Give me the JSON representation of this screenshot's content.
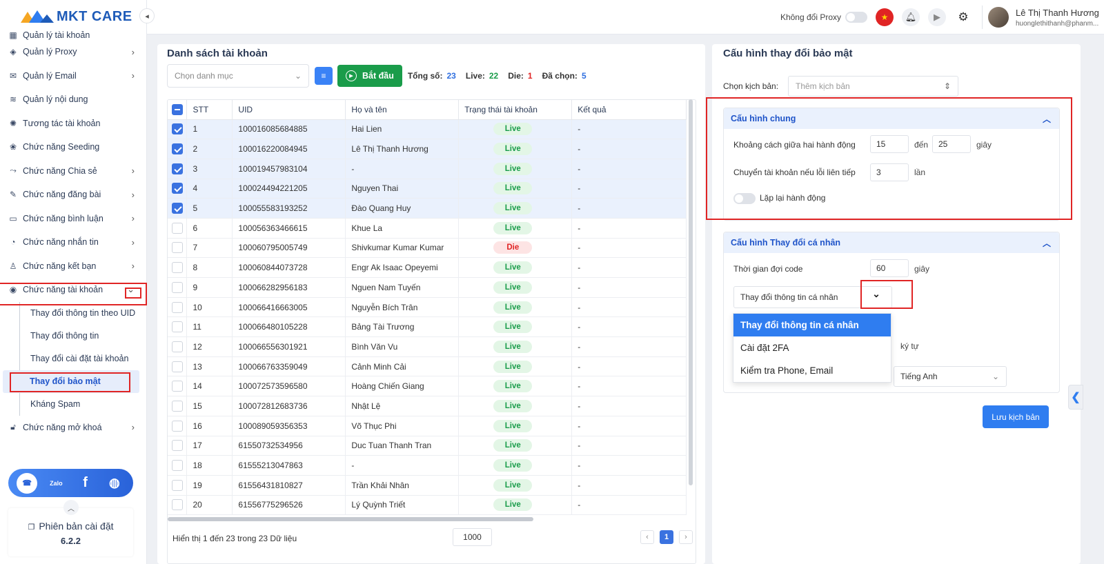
{
  "app": {
    "brand": "MKT CARE"
  },
  "sidebar": {
    "items": [
      {
        "label": "Quản lý tài khoản",
        "icon": "grid-icon"
      },
      {
        "label": "Quản lý Proxy",
        "icon": "layers-icon",
        "arrow": true
      },
      {
        "label": "Quản lý Email",
        "icon": "mail-icon",
        "arrow": true
      },
      {
        "label": "Quản lý nội dung",
        "icon": "content-icon"
      },
      {
        "label": "Tương tác tài khoản",
        "icon": "interact-icon"
      },
      {
        "label": "Chức năng Seeding",
        "icon": "seeding-icon"
      },
      {
        "label": "Chức năng Chia sẻ",
        "icon": "share-icon",
        "arrow": true
      },
      {
        "label": "Chức năng đăng bài",
        "icon": "post-icon",
        "arrow": true
      },
      {
        "label": "Chức năng bình luận",
        "icon": "comment-icon",
        "arrow": true
      },
      {
        "label": "Chức năng nhắn tin",
        "icon": "message-icon",
        "arrow": true
      },
      {
        "label": "Chức năng kết bạn",
        "icon": "add-friend-icon",
        "arrow": true
      },
      {
        "label": "Chức năng tài khoản",
        "icon": "user-circle-icon",
        "open": true
      }
    ],
    "subitems": [
      {
        "label": "Thay đổi thông tin theo UID"
      },
      {
        "label": "Thay đổi thông tin"
      },
      {
        "label": "Thay đổi cài đặt tài khoản"
      },
      {
        "label": "Thay đổi bảo mật",
        "active": true
      },
      {
        "label": "Kháng Spam"
      }
    ],
    "after": {
      "label": "Chức năng mở khoá",
      "icon": "lock-icon"
    },
    "version_label": "Phiên bản cài đặt",
    "version_number": "6.2.2"
  },
  "topbar": {
    "proxy_label": "Không đổi Proxy",
    "user_name": "Lê Thị Thanh Hương",
    "user_email": "huonglethithanh@phanm..."
  },
  "accounts": {
    "title": "Danh sách tài khoản",
    "category_placeholder": "Chọn danh mục",
    "start_label": "Bắt đầu",
    "stats": {
      "total_label": "Tổng số:",
      "total": "23",
      "live_label": "Live:",
      "live": "22",
      "die_label": "Die:",
      "die": "1",
      "selected_label": "Đã chọn:",
      "selected": "5"
    },
    "columns": [
      "STT",
      "UID",
      "Họ và tên",
      "Trạng thái tài khoản",
      "Kết quả"
    ],
    "rows": [
      {
        "stt": "1",
        "uid": "100016085684885",
        "name": "Hai Lien",
        "status": "Live",
        "result": "-",
        "checked": true
      },
      {
        "stt": "2",
        "uid": "100016220084945",
        "name": "Lê Thị Thanh Hương",
        "status": "Live",
        "result": "-",
        "checked": true
      },
      {
        "stt": "3",
        "uid": "100019457983104",
        "name": "-",
        "status": "Live",
        "result": "-",
        "checked": true
      },
      {
        "stt": "4",
        "uid": "100024494221205",
        "name": "Nguyen Thai",
        "status": "Live",
        "result": "-",
        "checked": true
      },
      {
        "stt": "5",
        "uid": "100055583193252",
        "name": "Đào Quang Huy",
        "status": "Live",
        "result": "-",
        "checked": true
      },
      {
        "stt": "6",
        "uid": "100056363466615",
        "name": "Khue La",
        "status": "Live",
        "result": "-",
        "checked": false
      },
      {
        "stt": "7",
        "uid": "100060795005749",
        "name": "Shivkumar Kumar Kumar",
        "status": "Die",
        "result": "-",
        "checked": false
      },
      {
        "stt": "8",
        "uid": "100060844073728",
        "name": "Engr Ak Isaac Opeyemi",
        "status": "Live",
        "result": "-",
        "checked": false
      },
      {
        "stt": "9",
        "uid": "100066282956183",
        "name": "Nguen Nam Tuyến",
        "status": "Live",
        "result": "-",
        "checked": false
      },
      {
        "stt": "10",
        "uid": "100066416663005",
        "name": "Nguyễn Bích Trân",
        "status": "Live",
        "result": "-",
        "checked": false
      },
      {
        "stt": "11",
        "uid": "100066480105228",
        "name": "Bảng Tài Trương",
        "status": "Live",
        "result": "-",
        "checked": false
      },
      {
        "stt": "12",
        "uid": "100066556301921",
        "name": "Bình Văn Vu",
        "status": "Live",
        "result": "-",
        "checked": false
      },
      {
        "stt": "13",
        "uid": "100066763359049",
        "name": "Cảnh Minh Cải",
        "status": "Live",
        "result": "-",
        "checked": false
      },
      {
        "stt": "14",
        "uid": "100072573596580",
        "name": "Hoàng Chiến Giang",
        "status": "Live",
        "result": "-",
        "checked": false
      },
      {
        "stt": "15",
        "uid": "100072812683736",
        "name": "Nhật Lệ",
        "status": "Live",
        "result": "-",
        "checked": false
      },
      {
        "stt": "16",
        "uid": "100089059356353",
        "name": "Võ Thục Phi",
        "status": "Live",
        "result": "-",
        "checked": false
      },
      {
        "stt": "17",
        "uid": "61550732534956",
        "name": "Duc Tuan Thanh Tran",
        "status": "Live",
        "result": "-",
        "checked": false
      },
      {
        "stt": "18",
        "uid": "61555213047863",
        "name": "-",
        "status": "Live",
        "result": "-",
        "checked": false
      },
      {
        "stt": "19",
        "uid": "61556431810827",
        "name": "Trần Khải Nhân",
        "status": "Live",
        "result": "-",
        "checked": false
      },
      {
        "stt": "20",
        "uid": "61556775296526",
        "name": "Lý Quỳnh Triết",
        "status": "Live",
        "result": "-",
        "checked": false
      }
    ],
    "footer_text": "Hiển thị 1 đến 23 trong 23 Dữ liệu",
    "page_size": "1000",
    "current_page": "1"
  },
  "config": {
    "title": "Cấu hình thay đổi bảo mật",
    "script_label": "Chọn kịch bản:",
    "script_placeholder": "Thêm kịch bản",
    "general": {
      "title": "Cấu hình chung",
      "interval_label": "Khoảng cách giữa hai hành động",
      "interval_from": "15",
      "to_label": "đến",
      "interval_to": "25",
      "seconds": "giây",
      "switch_label": "Chuyển tài khoản nếu lỗi liên tiếp",
      "switch_value": "3",
      "times": "lần",
      "repeat_label": "Lặp lại hành động"
    },
    "personal": {
      "title": "Cấu hình Thay đổi cá nhân",
      "wait_label": "Thời gian đợi code",
      "wait_value": "60",
      "seconds": "giây",
      "action_value": "Thay đổi thông tin cá nhân",
      "chars_label": "ký tự",
      "language_value": "Tiếng Anh"
    },
    "dropdown_options": [
      "Thay đổi thông tin cá nhân",
      "Cài đặt 2FA",
      "Kiểm tra Phone, Email"
    ],
    "save_label": "Lưu kịch bản"
  }
}
